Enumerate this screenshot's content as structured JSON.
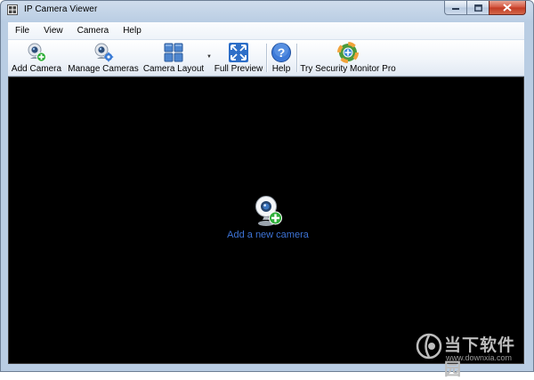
{
  "window": {
    "title": "IP Camera Viewer"
  },
  "menu": {
    "items": [
      "File",
      "View",
      "Camera",
      "Help"
    ]
  },
  "toolbar": {
    "add_camera": "Add Camera",
    "manage_cameras": "Manage Cameras",
    "camera_layout": "Camera Layout",
    "full_preview": "Full Preview",
    "help": "Help",
    "try_pro": "Try Security Monitor Pro"
  },
  "viewport": {
    "add_camera_link": "Add a new camera"
  },
  "watermark": {
    "name": "当下软件园",
    "url": "www.downxia.com"
  },
  "colors": {
    "viewport_bg": "#000000",
    "link": "#3d73d6",
    "titlebar": "#cfdcec"
  },
  "icons": {
    "add_camera": "webcam-plus-icon",
    "manage_cameras": "webcam-gear-icon",
    "camera_layout": "grid-layout-icon",
    "full_preview": "fullscreen-arrows-icon",
    "help": "question-circle-icon",
    "try_pro": "lifebuoy-icon"
  }
}
